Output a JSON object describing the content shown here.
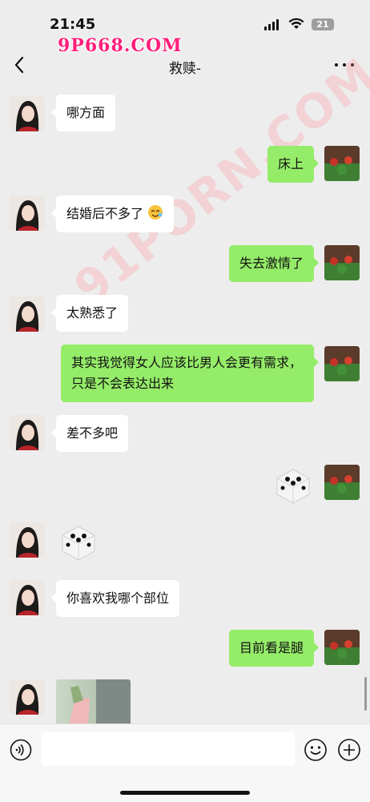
{
  "status": {
    "time": "21:45",
    "battery": "21"
  },
  "watermarks": {
    "top": "9P668.COM",
    "diagonal": "91PORN.COM"
  },
  "header": {
    "title": "救赎-"
  },
  "messages": [
    {
      "side": "in",
      "text": "哪方面"
    },
    {
      "side": "out",
      "text": "床上"
    },
    {
      "side": "in",
      "text": "结婚后不多了"
    },
    {
      "side": "out",
      "text": "失去激情了"
    },
    {
      "side": "in",
      "text": "太熟悉了"
    },
    {
      "side": "out",
      "text": "其实我觉得女人应该比男人会更有需求，只是不会表达出来"
    },
    {
      "side": "in",
      "text": "差不多吧"
    },
    {
      "side": "out",
      "type": "dice",
      "face": 5
    },
    {
      "side": "in",
      "type": "dice",
      "face": 5
    },
    {
      "side": "in",
      "text": "你喜欢我哪个部位"
    },
    {
      "side": "out",
      "text": "目前看是腿"
    },
    {
      "side": "in",
      "type": "image"
    }
  ],
  "input": {
    "value": ""
  },
  "colors": {
    "bubble_out": "#95ec69",
    "bubble_in": "#ffffff",
    "background": "#ededed"
  }
}
